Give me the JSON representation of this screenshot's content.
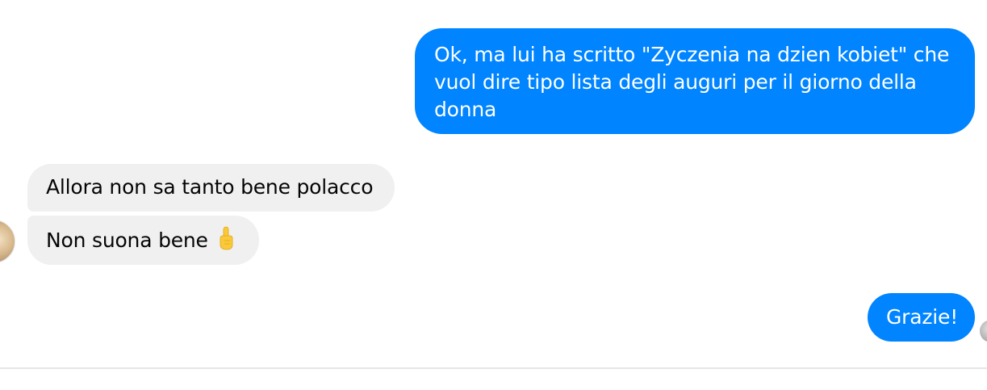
{
  "conversation": {
    "messages": [
      {
        "direction": "sent",
        "text": "Ok, ma lui ha scritto \"Zyczenia na dzien kobiet\" che vuol dire tipo lista degli auguri per il giorno della donna"
      },
      {
        "direction": "received",
        "text": "Allora non sa tanto bene polacco"
      },
      {
        "direction": "received",
        "text": "Non suona bene",
        "emoji": "pointing-up-hand-icon"
      },
      {
        "direction": "sent",
        "text": "Grazie!"
      }
    ]
  },
  "colors": {
    "sent_bubble": "#0084ff",
    "received_bubble": "#f0f0f0",
    "sent_text": "#ffffff",
    "received_text": "#050505",
    "divider": "#e4e6eb"
  }
}
